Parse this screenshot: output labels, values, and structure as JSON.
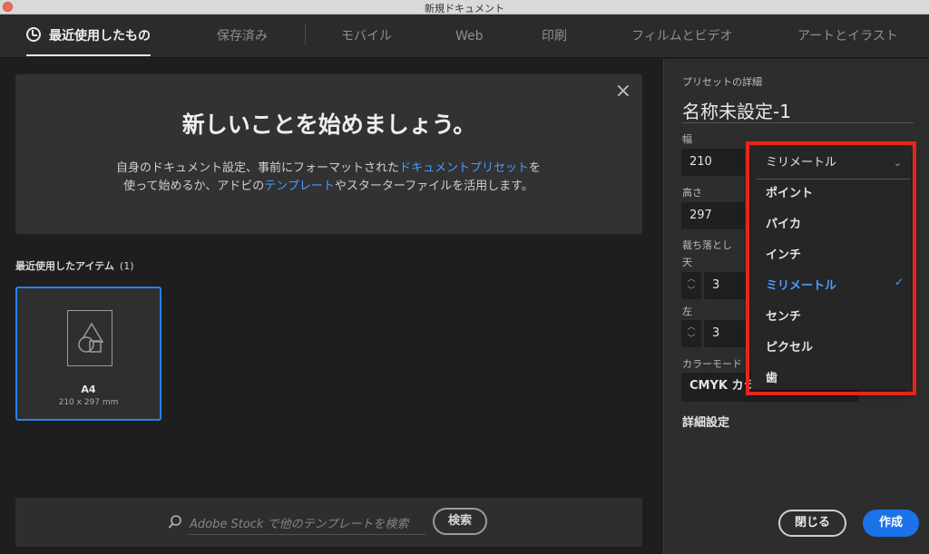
{
  "window": {
    "title": "新規ドキュメント"
  },
  "tabs": [
    {
      "label": "最近使用したもの",
      "active": true
    },
    {
      "label": "保存済み"
    },
    {
      "label": "モバイル"
    },
    {
      "label": "Web"
    },
    {
      "label": "印刷"
    },
    {
      "label": "フィルムとビデオ"
    },
    {
      "label": "アートとイラスト"
    }
  ],
  "welcome": {
    "title": "新しいことを始めましょう。",
    "desc_1": "自身のドキュメント設定、事前にフォーマットされた",
    "link_1": "ドキュメントプリセット",
    "desc_2": "を使って始めるか、アドビの",
    "link_2": "テンプレート",
    "desc_3": "やスターターファイルを活用します。",
    "close_icon": "×"
  },
  "recent": {
    "label": "最近使用したアイテム",
    "count": "(1)",
    "items": [
      {
        "name": "A4",
        "size": "210 x 297 mm"
      }
    ]
  },
  "search": {
    "placeholder": "Adobe Stock で他のテンプレートを検索",
    "button": "検索"
  },
  "preset": {
    "section_label": "プリセットの詳細",
    "doc_name": "名称未設定-1",
    "width_label": "幅",
    "width_value": "210",
    "height_label": "高さ",
    "height_value": "297",
    "bleed_label": "裁ち落とし",
    "top_label": "天",
    "top_value": "3",
    "left_label": "左",
    "left_value": "3",
    "color_mode_label": "カラーモード",
    "color_mode_value": "CMYK カラー",
    "advanced_label": "詳細設定",
    "close_button": "閉じる",
    "create_button": "作成"
  },
  "units_dropdown": {
    "selected": "ミリメートル",
    "options": [
      "ポイント",
      "パイカ",
      "インチ",
      "ミリメートル",
      "センチ",
      "ピクセル",
      "歯"
    ],
    "check_icon": "✓",
    "chevron_icon": "⌄"
  },
  "colors": {
    "accent": "#1a73e8",
    "highlight": "#e6251d"
  }
}
